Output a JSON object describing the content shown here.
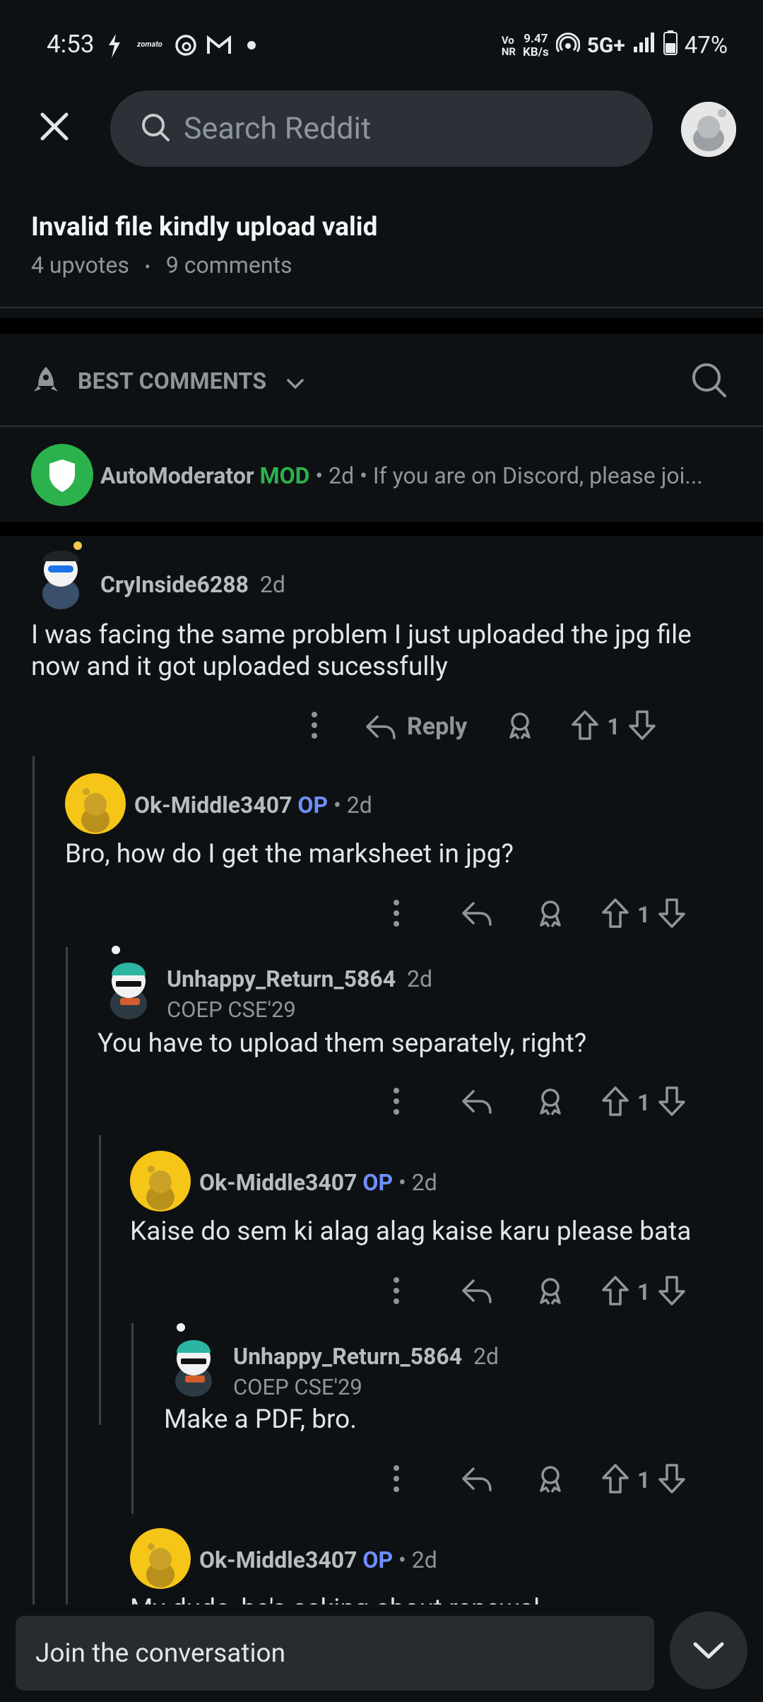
{
  "status_bar": {
    "time": "4:53",
    "net_speed": "9.47",
    "net_unit": "KB/s",
    "volte": "Vo",
    "volte2": "NR",
    "network": "5G+",
    "battery": "47%",
    "zomato": "zomato"
  },
  "header": {
    "search_placeholder": "Search Reddit"
  },
  "post": {
    "title": "Invalid file kindly upload valid",
    "upvotes": "4 upvotes",
    "comments": "9 comments",
    "sep": "•"
  },
  "sort": {
    "label": "BEST COMMENTS"
  },
  "automod": {
    "username": "AutoModerator",
    "badge": "MOD",
    "age": "2d",
    "preview": "If you are on Discord, please joi..."
  },
  "comments": [
    {
      "username": "CryInside6288",
      "age": "2d",
      "body_line1": "I was facing the same problem I just uploaded the jpg file",
      "body_line2": "now and it got uploaded sucessfully",
      "reply_label": "Reply",
      "votes": "1"
    },
    {
      "username": "Ok-Middle3407",
      "op": "OP",
      "age": "2d",
      "body": "Bro, how do I get the marksheet in jpg?",
      "votes": "1"
    },
    {
      "username": "Unhappy_Return_5864",
      "age": "2d",
      "flair": "COEP CSE'29",
      "body": "You have to upload them separately, right?",
      "votes": "1"
    },
    {
      "username": "Ok-Middle3407",
      "op": "OP",
      "age": "2d",
      "body": "Kaise do sem ki alag alag kaise karu please bata",
      "votes": "1"
    },
    {
      "username": "Unhappy_Return_5864",
      "age": "2d",
      "flair": "COEP CSE'29",
      "body": "Make a PDF, bro.",
      "votes": "1"
    },
    {
      "username": "Ok-Middle3407",
      "op": "OP",
      "age": "2d",
      "body": "My dude, he's asking about renewal"
    }
  ],
  "bottom": {
    "join_label": "Join the conversation"
  }
}
